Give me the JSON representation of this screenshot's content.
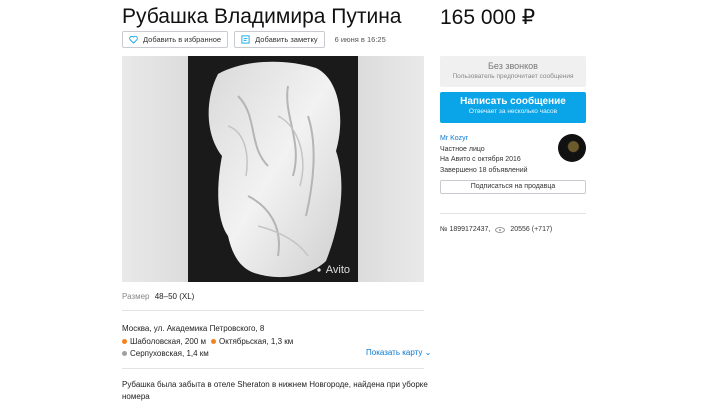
{
  "listing": {
    "title": "Рубашка Владимира Путина",
    "price": "165 000 ₽",
    "add_favorite_label": "Добавить в избранное",
    "add_note_label": "Добавить заметку",
    "posted_date": "6 июня в 16:25",
    "watermark": "Avito"
  },
  "details": {
    "size_label": "Размер",
    "size_value": "48–50 (XL)"
  },
  "location": {
    "address": "Москва, ул. Академика Петровского, 8",
    "metro": [
      {
        "name": "Шаболовская",
        "distance": "200 м",
        "color": "#f58220"
      },
      {
        "name": "Октябрьская",
        "distance": "1,3 км",
        "color": "#f58220"
      },
      {
        "name": "Серпуховская",
        "distance": "1,4 км",
        "color": "#a0a0a0"
      }
    ],
    "show_map": "Показать карту"
  },
  "description": "Рубашка была забыта в отеле Sheraton в нижнем Новгороде, найдена при уборке номера",
  "contact": {
    "no_calls_title": "Без звонков",
    "no_calls_sub": "Пользователь предпочитает сообщения",
    "write_title": "Написать сообщение",
    "write_sub": "Отвечает за несколько часов"
  },
  "seller": {
    "name": "Mr Kozyr",
    "type": "Частное лицо",
    "since": "На Авито с октября 2016",
    "completed": "Завершено 18 объявлений",
    "subscribe": "Подписаться на продавца"
  },
  "stats": {
    "id": "№ 1899172437,",
    "views": "20556 (+717)"
  },
  "colors": {
    "accent": "#09a5e8",
    "link": "#0a79d1"
  }
}
